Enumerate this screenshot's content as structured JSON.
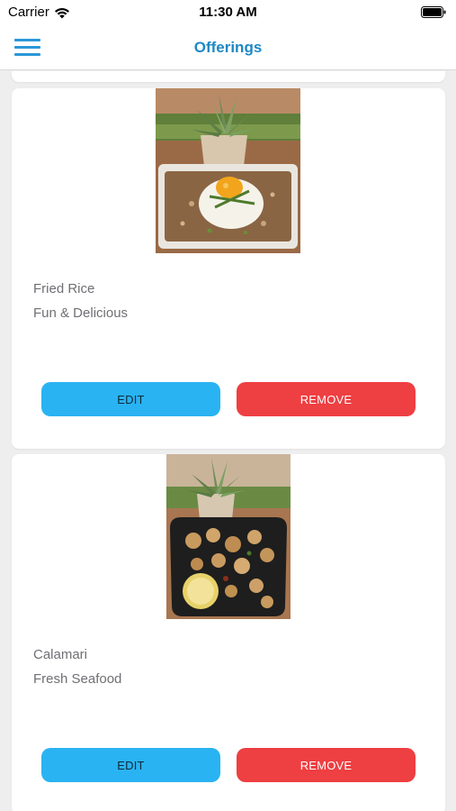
{
  "status_bar": {
    "carrier": "Carrier",
    "time": "11:30 AM"
  },
  "nav": {
    "title": "Offerings",
    "menu_icon": "hamburger-menu-icon",
    "accent_color": "#1e88c4"
  },
  "offerings": [
    {
      "name": "Fried Rice",
      "description": "Fun & Delicious",
      "image": "fried-rice-photo",
      "edit_label": "EDIT",
      "remove_label": "REMOVE"
    },
    {
      "name": "Calamari",
      "description": "Fresh Seafood",
      "image": "calamari-photo",
      "edit_label": "EDIT",
      "remove_label": "REMOVE"
    }
  ],
  "colors": {
    "edit_button": "#2ab3f2",
    "remove_button": "#ee3f42",
    "background": "#eeeeef"
  }
}
